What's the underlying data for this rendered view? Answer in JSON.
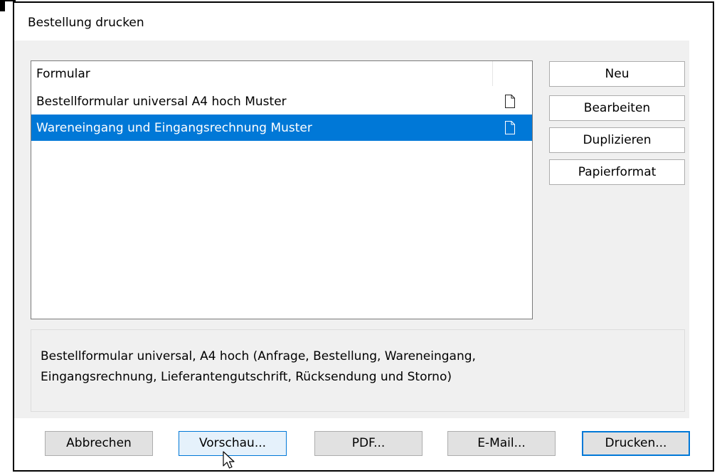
{
  "window": {
    "title": "Bestellung drucken"
  },
  "list": {
    "header": "Formular",
    "rows": [
      {
        "label": "Bestellformular universal A4 hoch Muster",
        "icon": "document-icon",
        "selected": false
      },
      {
        "label": "Wareneingang und Eingangsrechnung Muster",
        "icon": "document-icon",
        "selected": true
      }
    ]
  },
  "side_buttons": {
    "new": "Neu",
    "edit": "Bearbeiten",
    "duplicate": "Duplizieren",
    "paper_format": "Papierformat"
  },
  "description": {
    "line1": "Bestellformular universal, A4 hoch (Anfrage, Bestellung, Wareneingang,",
    "line2": "Eingangsrechnung, Lieferantengutschrift, Rücksendung und Storno)"
  },
  "bottom_buttons": {
    "cancel": "Abbrechen",
    "preview": "Vorschau...",
    "pdf": "PDF...",
    "email": "E-Mail...",
    "print": "Drucken..."
  },
  "colors": {
    "selection": "#0078d7",
    "panel": "#f0f0f0",
    "button": "#e1e1e1",
    "focus_border": "#0078d7"
  }
}
